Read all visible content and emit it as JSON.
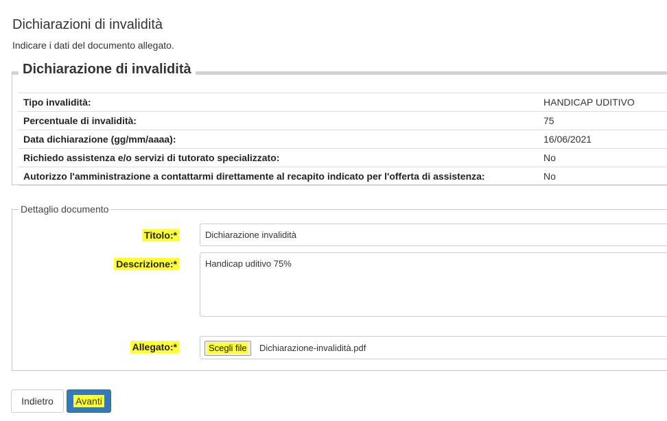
{
  "page": {
    "title": "Dichiarazioni di invalidità",
    "intro": "Indicare i dati del documento allegato."
  },
  "summary": {
    "legend": "Dichiarazione di invalidità",
    "rows": [
      {
        "label": "Tipo invalidità:",
        "value": "HANDICAP UDITIVO"
      },
      {
        "label": "Percentuale di invalidità:",
        "value": "75"
      },
      {
        "label": "Data dichiarazione (gg/mm/aaaa):",
        "value": "16/06/2021"
      },
      {
        "label": "Richiedo assistenza e/o servizi di tutorato specializzato:",
        "value": "No"
      },
      {
        "label": "Autorizzo l'amministrazione a contattarmi direttamente al recapito indicato per l'offerta di assistenza:",
        "value": "No"
      }
    ]
  },
  "detail": {
    "legend": "Dettaglio documento",
    "titolo_label": "Titolo:*",
    "titolo_value": "Dichiarazione invalidità",
    "descrizione_label": "Descrizione:*",
    "descrizione_value": "Handicap uditivo 75%",
    "allegato_label": "Allegato:*",
    "file_button": "Scegli file",
    "file_name": "Dichiarazione-invalidità.pdf"
  },
  "actions": {
    "back": "Indietro",
    "next": "Avanti"
  },
  "colors": {
    "highlight": "#ffff33",
    "primary": "#337ab7"
  }
}
